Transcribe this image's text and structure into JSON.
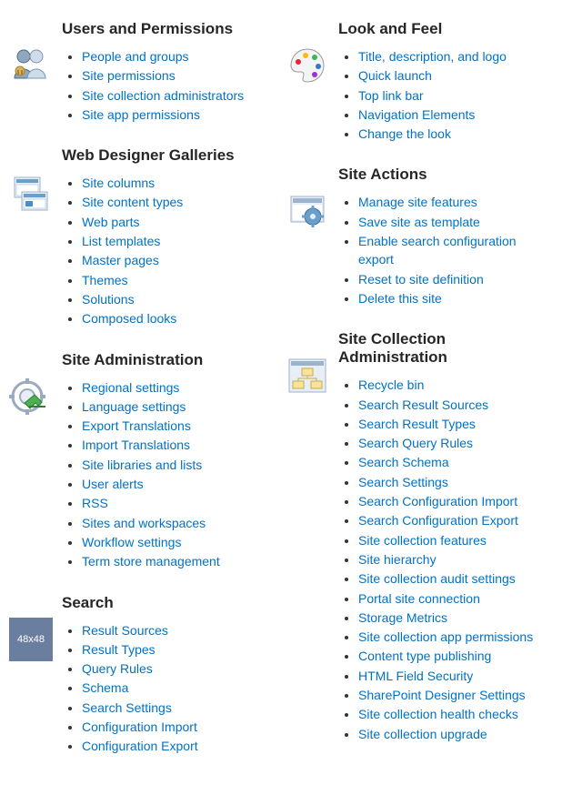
{
  "left": [
    {
      "icon": "users",
      "heading": "Users and Permissions",
      "items": [
        "People and groups",
        "Site permissions",
        "Site collection administrators",
        "Site app permissions"
      ]
    },
    {
      "icon": "galleries",
      "heading": "Web Designer Galleries",
      "items": [
        "Site columns",
        "Site content types",
        "Web parts",
        "List templates",
        "Master pages",
        "Themes",
        "Solutions",
        "Composed looks"
      ]
    },
    {
      "icon": "admin",
      "heading": "Site Administration",
      "items": [
        "Regional settings",
        "Language settings",
        "Export Translations",
        "Import Translations",
        "Site libraries and lists",
        "User alerts",
        "RSS",
        "Sites and workspaces",
        "Workflow settings",
        "Term store management"
      ]
    },
    {
      "icon": "placeholder",
      "heading": "Search",
      "items": [
        "Result Sources",
        "Result Types",
        "Query Rules",
        "Schema",
        "Search Settings",
        "Configuration Import",
        "Configuration Export"
      ]
    }
  ],
  "right": [
    {
      "icon": "look",
      "heading": "Look and Feel",
      "items": [
        "Title, description, and logo",
        "Quick launch",
        "Top link bar",
        "Navigation Elements",
        "Change the look"
      ]
    },
    {
      "icon": "actions",
      "heading": "Site Actions",
      "items": [
        "Manage site features",
        "Save site as template",
        "Enable search configuration export",
        "Reset to site definition",
        "Delete this site"
      ]
    },
    {
      "icon": "collection",
      "heading": "Site Collection Administration",
      "items": [
        "Recycle bin",
        "Search Result Sources",
        "Search Result Types",
        "Search Query Rules",
        "Search Schema",
        "Search Settings",
        "Search Configuration Import",
        "Search Configuration Export",
        "Site collection features",
        "Site hierarchy",
        "Site collection audit settings",
        "Portal site connection",
        "Storage Metrics",
        "Site collection app permissions",
        "Content type publishing",
        "HTML Field Security",
        "SharePoint Designer Settings",
        "Site collection health checks",
        "Site collection upgrade"
      ]
    }
  ],
  "placeholder_label": "48x48"
}
